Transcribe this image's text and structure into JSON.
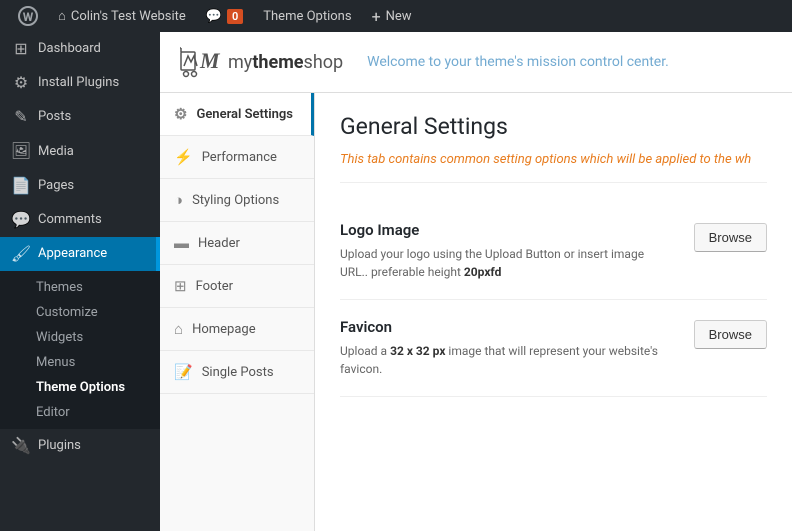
{
  "adminbar": {
    "logo_label": "WordPress",
    "site_name": "Colin's Test Website",
    "comments_count": "0",
    "theme_options_label": "Theme Options",
    "new_label": "New"
  },
  "sidebar": {
    "items": [
      {
        "id": "dashboard",
        "label": "Dashboard",
        "icon": "⊞"
      },
      {
        "id": "install-plugins",
        "label": "Install Plugins",
        "icon": "⚙"
      },
      {
        "id": "posts",
        "label": "Posts",
        "icon": "✎"
      },
      {
        "id": "media",
        "label": "Media",
        "icon": "🖼"
      },
      {
        "id": "pages",
        "label": "Pages",
        "icon": "📄"
      },
      {
        "id": "comments",
        "label": "Comments",
        "icon": "💬"
      }
    ],
    "appearance": {
      "label": "Appearance",
      "sub_items": [
        {
          "id": "themes",
          "label": "Themes"
        },
        {
          "id": "customize",
          "label": "Customize"
        },
        {
          "id": "widgets",
          "label": "Widgets"
        },
        {
          "id": "menus",
          "label": "Menus"
        },
        {
          "id": "theme-options",
          "label": "Theme Options",
          "active": true
        },
        {
          "id": "editor",
          "label": "Editor"
        }
      ]
    },
    "plugins": {
      "label": "Plugins"
    }
  },
  "theme_options": {
    "logo_brand": "my",
    "logo_brand2": "theme",
    "logo_brand3": "shop",
    "welcome_text": "Welcome to your theme's mission control center.",
    "nav_items": [
      {
        "id": "general",
        "label": "General Settings",
        "icon": "⚙",
        "active": true
      },
      {
        "id": "performance",
        "label": "Performance",
        "icon": "⚡"
      },
      {
        "id": "styling",
        "label": "Styling Options",
        "icon": "◑"
      },
      {
        "id": "header",
        "label": "Header",
        "icon": "▬"
      },
      {
        "id": "footer",
        "label": "Footer",
        "icon": "⊞"
      },
      {
        "id": "homepage",
        "label": "Homepage",
        "icon": "⌂"
      },
      {
        "id": "single-posts",
        "label": "Single Posts",
        "icon": "📝"
      }
    ],
    "content": {
      "title": "General Settings",
      "description": "This tab contains common setting options which will be applied to the wh",
      "settings": [
        {
          "id": "logo",
          "title": "Logo Image",
          "description": "Upload your logo using the Upload Button or insert image URL.. preferable height",
          "description_bold": "20pxfd",
          "button_label": "Browse"
        },
        {
          "id": "favicon",
          "title": "Favicon",
          "description": "Upload a",
          "description_bold_1": "32 x 32 px",
          "description2": "image that will represent your website's favicon.",
          "button_label": "Browse"
        }
      ]
    }
  }
}
